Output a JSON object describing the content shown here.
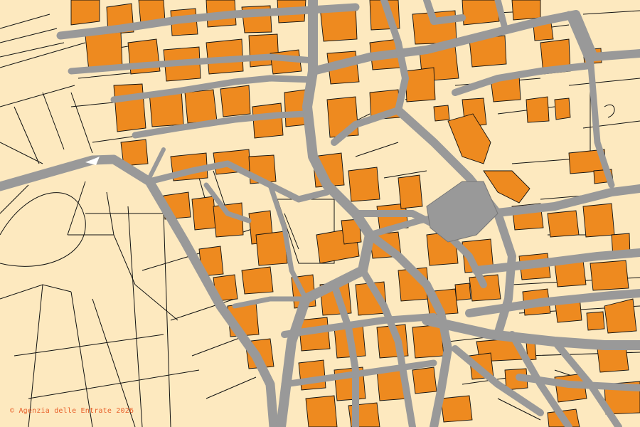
{
  "attribution": "© Agenzia delle Entrate 2026",
  "colors": {
    "land": "#fde9bf",
    "building": "#ee8a1f",
    "road": "#9a9a9a",
    "parcel_line": "#111111",
    "attribution_text": "#e8602a"
  }
}
